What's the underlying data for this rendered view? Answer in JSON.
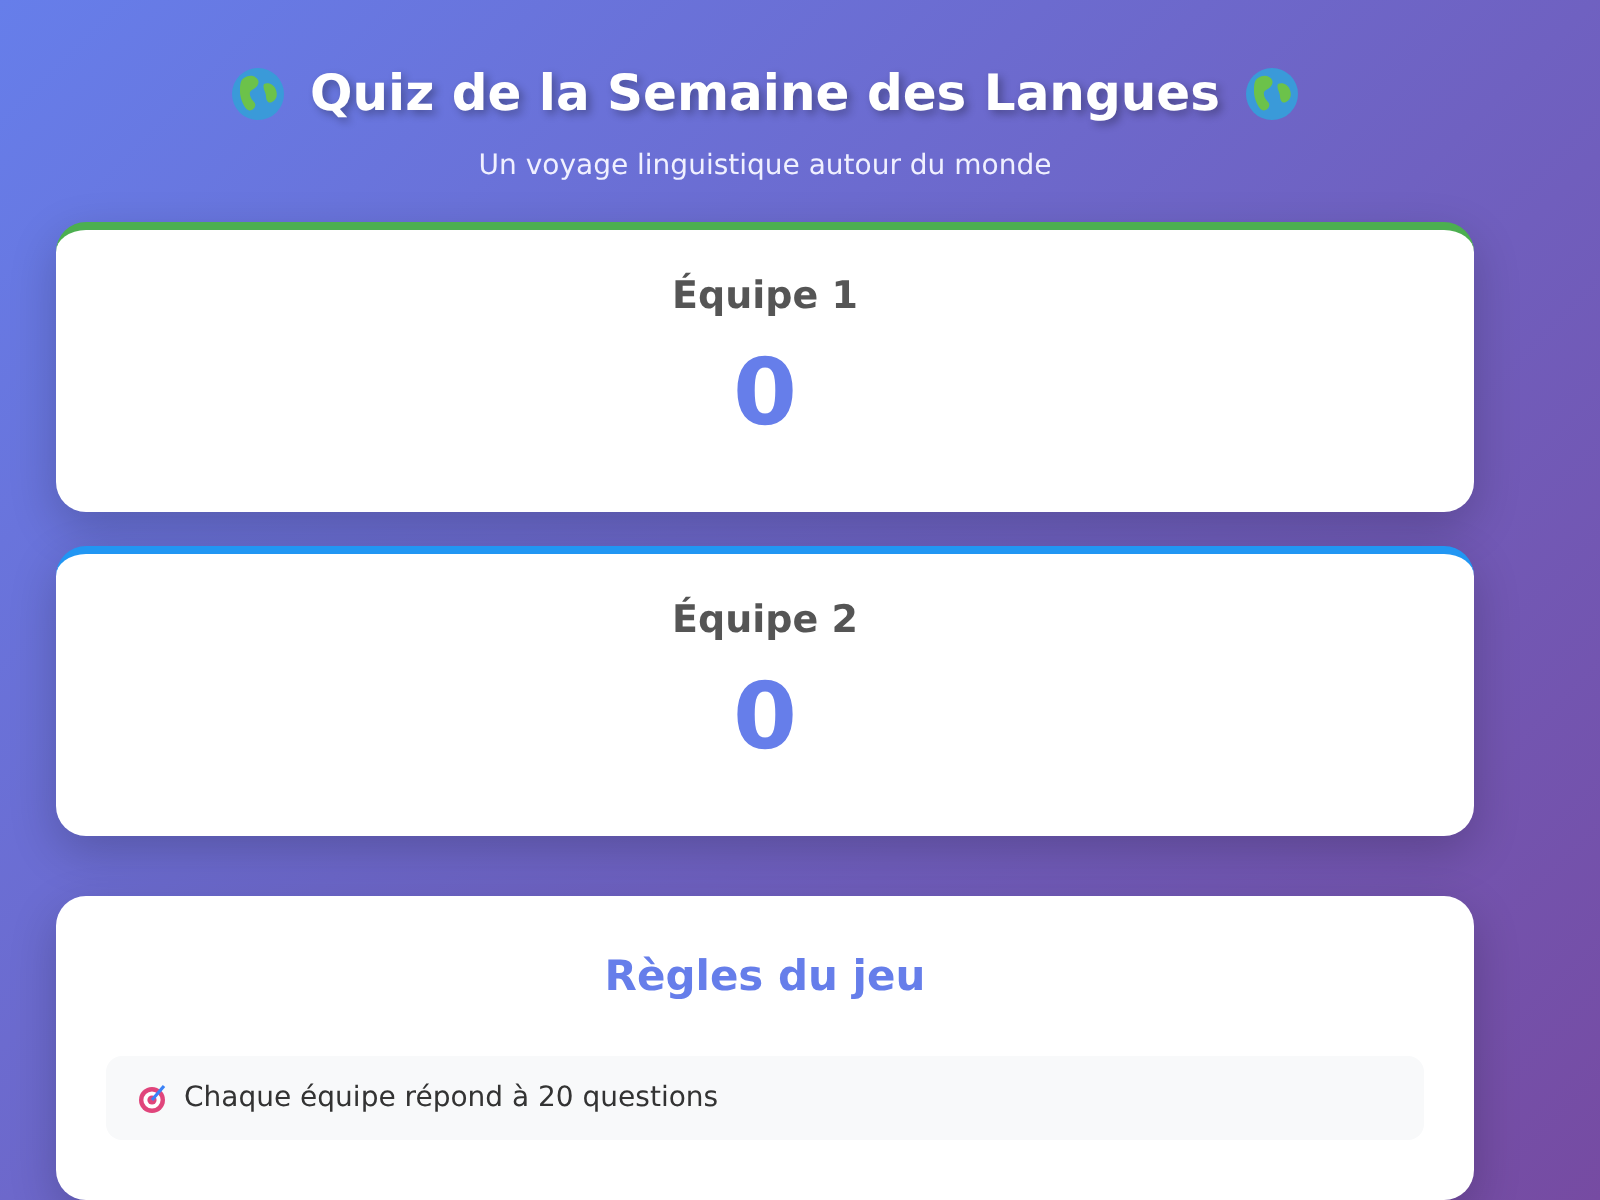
{
  "header": {
    "title": "Quiz de la Semaine des Langues",
    "subtitle": "Un voyage linguistique autour du monde"
  },
  "teams": [
    {
      "name": "Équipe 1",
      "score": "0",
      "color": "#4caf50"
    },
    {
      "name": "Équipe 2",
      "score": "0",
      "color": "#2196f3"
    }
  ],
  "rules": {
    "title": "Règles du jeu",
    "items": [
      "Chaque équipe répond à 20 questions"
    ]
  }
}
